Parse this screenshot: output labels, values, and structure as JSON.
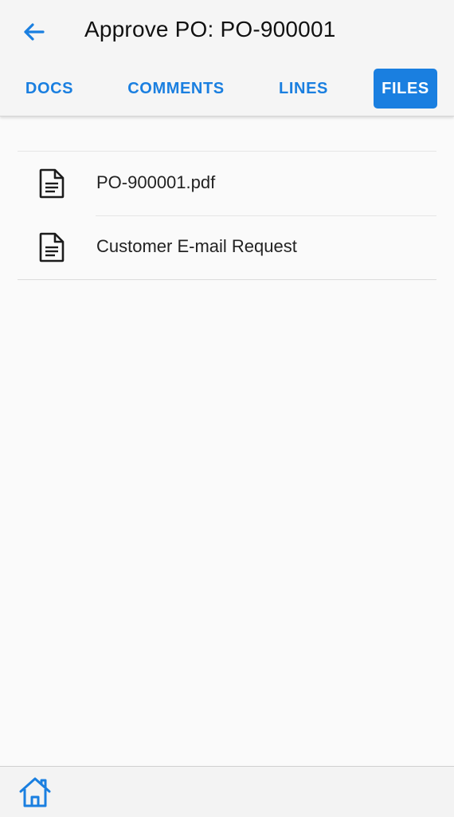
{
  "header": {
    "back_icon": "arrow-left-icon",
    "title": "Approve PO: PO-900001"
  },
  "tabs": [
    {
      "label": "DOCS",
      "active": false
    },
    {
      "label": "COMMENTS",
      "active": false
    },
    {
      "label": "LINES",
      "active": false
    },
    {
      "label": "FILES",
      "active": true
    }
  ],
  "files": [
    {
      "name": "PO-900001.pdf",
      "icon": "document-icon"
    },
    {
      "name": "Customer E-mail Request",
      "icon": "document-icon"
    }
  ],
  "bottom_bar": {
    "home_icon": "home-icon"
  },
  "colors": {
    "accent": "#1a7fe0",
    "header_bg": "#f5f5f5",
    "page_bg": "#fafafa"
  }
}
